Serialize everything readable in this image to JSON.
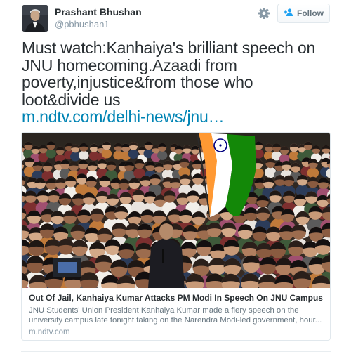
{
  "tweet": {
    "author": {
      "name": "Prashant Bhushan",
      "handle": "@pbhushan1"
    },
    "follow_label": "Follow",
    "text": "Must watch:Kanhaiya's brilliant speech on JNU homecoming.Azaadi from poverty,injustice&from those who loot&divide us",
    "link_text": "m.ndtv.com/delhi-news/jnu…",
    "card": {
      "title": "Out Of Jail, Kanhaiya Kumar Attacks PM Modi In Speech On JNU Campus",
      "description": "JNU Students' Union President Kanhaiya Kumar made a fiery speech on the university campus late tonight taking on the Narendra Modi-led government, hour...",
      "domain": "m.ndtv.com"
    }
  },
  "icons": {
    "settings": "gear-icon",
    "follow": "user-plus-icon"
  },
  "colors": {
    "link": "#0084b4",
    "text": "#292f33",
    "muted": "#8899a6",
    "follow_icon": "#1da1f2",
    "flag_saffron": "#ff9933",
    "flag_green": "#138808",
    "flag_chakra": "#000080"
  }
}
